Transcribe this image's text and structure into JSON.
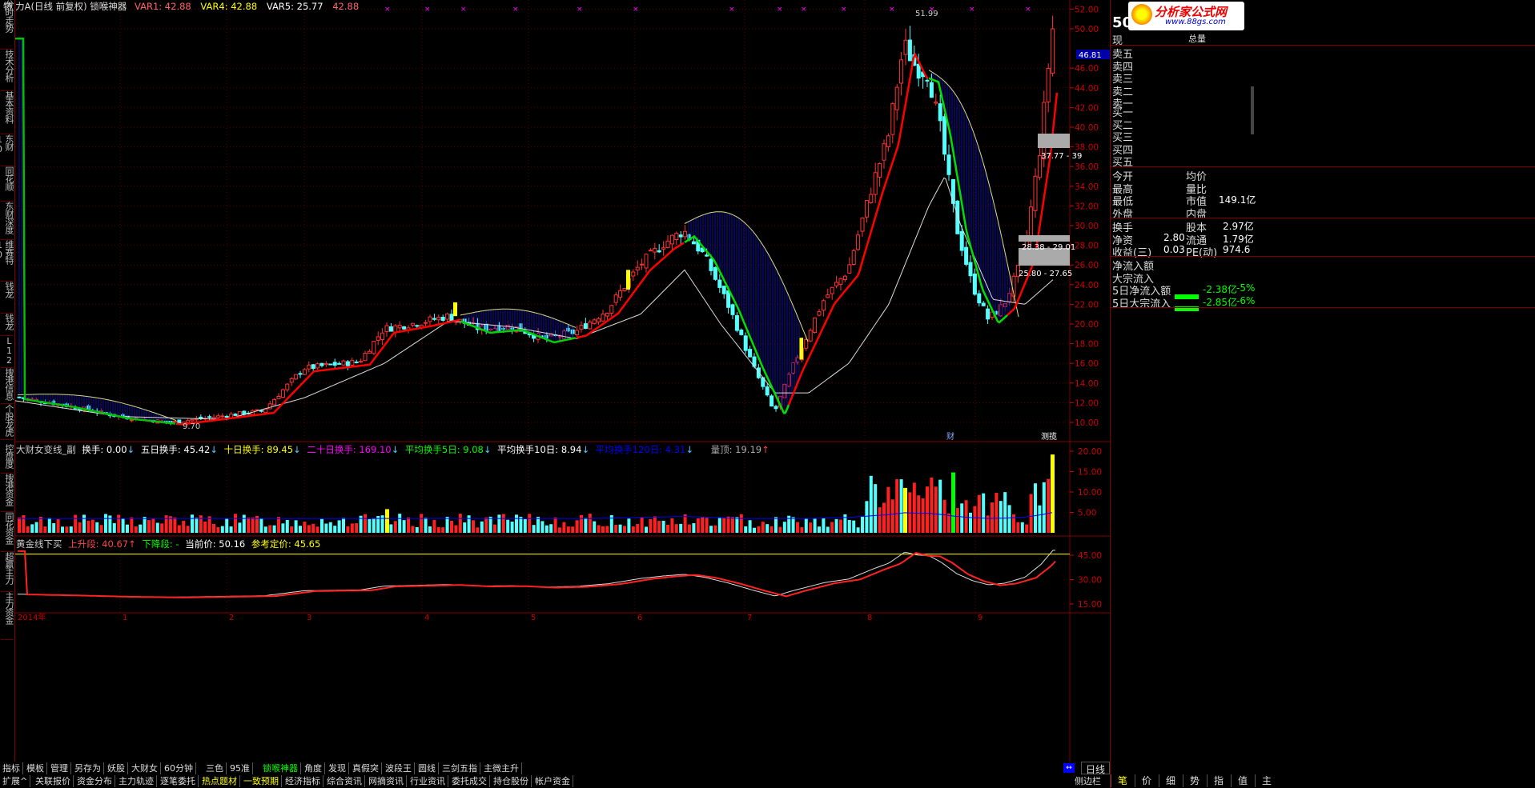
{
  "title_bar": {
    "text": "特 力A(日线 前复权) 锁喉神器",
    "var1": "VAR1: 42.88",
    "var4": "VAR4: 42.88",
    "var5": "VAR5: 25.77",
    "val": "42.88"
  },
  "left_tabs": [
    "分时走势",
    "技术分析",
    "基本资料",
    "东财10",
    "同花顺",
    "东财深度",
    "维赛特10",
    "钱龙",
    "钱龙",
    "L12",
    "搜港信息",
    "个股龙虎"
  ],
  "left_tabs_lower": [
    "控盘度",
    "搜港资金",
    "同花资金",
    "超赢主力",
    "主力资金"
  ],
  "main_chart": {
    "y_ticks": [
      "52.00",
      "50.00",
      "46.00",
      "44.00",
      "42.00",
      "40.00",
      "38.00",
      "36.00",
      "34.00",
      "32.00",
      "30.00",
      "28.00",
      "26.00",
      "24.00",
      "22.00",
      "20.00",
      "18.00",
      "16.00",
      "14.00",
      "12.00",
      "10.00"
    ],
    "high_label": "51.99",
    "low_label": "9.70",
    "cursor_price": "46.81",
    "zone1": "37.77 - 39",
    "zone2": "28.38 - 29.01",
    "zone3": "25.80 - 27.65",
    "marker_cai": "财",
    "marker_x": "测揽"
  },
  "sub1": {
    "name": "大财女变线_副",
    "hs": "换手: 0.00",
    "h5": "五日换手: 45.42",
    "h10": "十日换手: 89.45",
    "h20": "二十日换手: 169.10",
    "avg5": "平均换手5日: 9.08",
    "avg10": "平均换手10日: 8.94",
    "avg120": "平均换手120日: 4.31",
    "vol": "量顶: 19.19",
    "y_ticks": [
      "20.00",
      "15.00",
      "10.00",
      "5.00"
    ]
  },
  "sub2": {
    "name": "黄金线下买",
    "up": "上升段: 40.67",
    "down": "下降段: -",
    "cur": "当前价: 50.16",
    "ref": "参考定价: 45.65",
    "y_ticks": [
      "45.00",
      "30.00",
      "15.00"
    ]
  },
  "x_axis": [
    "2014年",
    "1",
    "2",
    "3",
    "4",
    "5",
    "6",
    "7",
    "8",
    "9"
  ],
  "right_panel": {
    "code": "50",
    "logo": "分析家公式网",
    "logo_url": "www.88gs.com",
    "now_label": "现",
    "total_label": "总量",
    "sell": [
      "卖五",
      "卖四",
      "卖三",
      "卖二",
      "卖一"
    ],
    "buy": [
      "买一",
      "买二",
      "买三",
      "买四",
      "买五"
    ],
    "stats_left": [
      "今开",
      "最高",
      "最低",
      "外盘"
    ],
    "stats_right_label": [
      "均价",
      "量比",
      "市值",
      "内盘"
    ],
    "stats_right_val": [
      "",
      "",
      "149.1亿",
      ""
    ],
    "fin_left": [
      "换手",
      "净资",
      "收益(三)"
    ],
    "fin_left_val": [
      "",
      "2.80",
      "0.03"
    ],
    "fin_right": [
      "股本",
      "流通",
      "PE(动)"
    ],
    "fin_right_val": [
      "2.97亿",
      "1.79亿",
      "974.6"
    ],
    "flow": [
      "净流入额",
      "大宗流入",
      "5日净流入额",
      "5日大宗流入"
    ],
    "flow_val": [
      "",
      "",
      "-2.38亿",
      "-2.85亿"
    ],
    "flow_pct": [
      "",
      "",
      "-5%",
      "-6%"
    ]
  },
  "bottom_tabs_row1": [
    "指标",
    "模板",
    "管理",
    "另存为",
    "妖股",
    "大财女",
    "60分钟",
    "三色",
    "95准",
    "锁喉神器",
    "角度",
    "发现",
    "真假突",
    "波段王",
    "圆线",
    "三剑五指",
    "主微主升"
  ],
  "bottom_tabs_row2": [
    "扩展^",
    "关联报价",
    "资金分布",
    "主力轨迹",
    "逐笔委托",
    "热点题材",
    "一致预期",
    "经济指标",
    "综合资讯",
    "网摘资讯",
    "行业资讯",
    "委托成交",
    "持仓股份",
    "帐户资金"
  ],
  "right_bottom": {
    "period": "日线",
    "tabs": [
      "笔",
      "价",
      "细",
      "势",
      "指",
      "值",
      "主"
    ],
    "side": "侧边栏"
  },
  "colors": {
    "up": "#ff3232",
    "down": "#54ffff",
    "ma_up": "#ff0000",
    "ma_down": "#00ff00",
    "fill": "#000080"
  }
}
